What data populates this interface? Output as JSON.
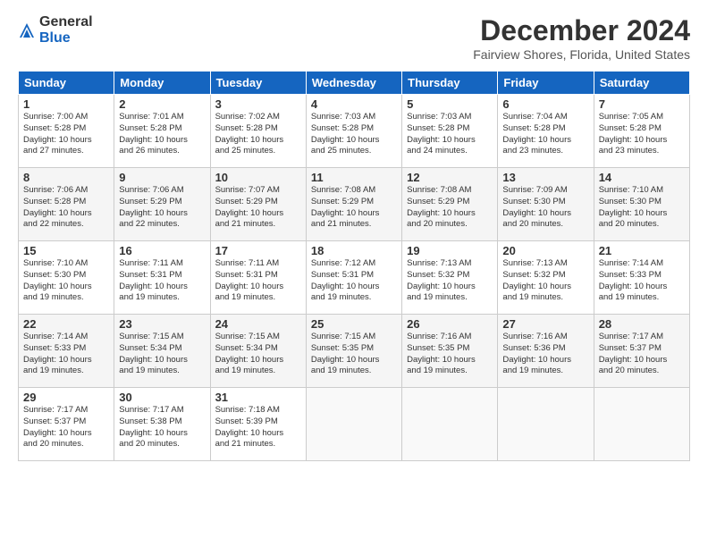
{
  "header": {
    "logo_general": "General",
    "logo_blue": "Blue",
    "title": "December 2024",
    "location": "Fairview Shores, Florida, United States"
  },
  "weekdays": [
    "Sunday",
    "Monday",
    "Tuesday",
    "Wednesday",
    "Thursday",
    "Friday",
    "Saturday"
  ],
  "weeks": [
    [
      {
        "day": "1",
        "info": "Sunrise: 7:00 AM\nSunset: 5:28 PM\nDaylight: 10 hours\nand 27 minutes."
      },
      {
        "day": "2",
        "info": "Sunrise: 7:01 AM\nSunset: 5:28 PM\nDaylight: 10 hours\nand 26 minutes."
      },
      {
        "day": "3",
        "info": "Sunrise: 7:02 AM\nSunset: 5:28 PM\nDaylight: 10 hours\nand 25 minutes."
      },
      {
        "day": "4",
        "info": "Sunrise: 7:03 AM\nSunset: 5:28 PM\nDaylight: 10 hours\nand 25 minutes."
      },
      {
        "day": "5",
        "info": "Sunrise: 7:03 AM\nSunset: 5:28 PM\nDaylight: 10 hours\nand 24 minutes."
      },
      {
        "day": "6",
        "info": "Sunrise: 7:04 AM\nSunset: 5:28 PM\nDaylight: 10 hours\nand 23 minutes."
      },
      {
        "day": "7",
        "info": "Sunrise: 7:05 AM\nSunset: 5:28 PM\nDaylight: 10 hours\nand 23 minutes."
      }
    ],
    [
      {
        "day": "8",
        "info": "Sunrise: 7:06 AM\nSunset: 5:28 PM\nDaylight: 10 hours\nand 22 minutes."
      },
      {
        "day": "9",
        "info": "Sunrise: 7:06 AM\nSunset: 5:29 PM\nDaylight: 10 hours\nand 22 minutes."
      },
      {
        "day": "10",
        "info": "Sunrise: 7:07 AM\nSunset: 5:29 PM\nDaylight: 10 hours\nand 21 minutes."
      },
      {
        "day": "11",
        "info": "Sunrise: 7:08 AM\nSunset: 5:29 PM\nDaylight: 10 hours\nand 21 minutes."
      },
      {
        "day": "12",
        "info": "Sunrise: 7:08 AM\nSunset: 5:29 PM\nDaylight: 10 hours\nand 20 minutes."
      },
      {
        "day": "13",
        "info": "Sunrise: 7:09 AM\nSunset: 5:30 PM\nDaylight: 10 hours\nand 20 minutes."
      },
      {
        "day": "14",
        "info": "Sunrise: 7:10 AM\nSunset: 5:30 PM\nDaylight: 10 hours\nand 20 minutes."
      }
    ],
    [
      {
        "day": "15",
        "info": "Sunrise: 7:10 AM\nSunset: 5:30 PM\nDaylight: 10 hours\nand 19 minutes."
      },
      {
        "day": "16",
        "info": "Sunrise: 7:11 AM\nSunset: 5:31 PM\nDaylight: 10 hours\nand 19 minutes."
      },
      {
        "day": "17",
        "info": "Sunrise: 7:11 AM\nSunset: 5:31 PM\nDaylight: 10 hours\nand 19 minutes."
      },
      {
        "day": "18",
        "info": "Sunrise: 7:12 AM\nSunset: 5:31 PM\nDaylight: 10 hours\nand 19 minutes."
      },
      {
        "day": "19",
        "info": "Sunrise: 7:13 AM\nSunset: 5:32 PM\nDaylight: 10 hours\nand 19 minutes."
      },
      {
        "day": "20",
        "info": "Sunrise: 7:13 AM\nSunset: 5:32 PM\nDaylight: 10 hours\nand 19 minutes."
      },
      {
        "day": "21",
        "info": "Sunrise: 7:14 AM\nSunset: 5:33 PM\nDaylight: 10 hours\nand 19 minutes."
      }
    ],
    [
      {
        "day": "22",
        "info": "Sunrise: 7:14 AM\nSunset: 5:33 PM\nDaylight: 10 hours\nand 19 minutes."
      },
      {
        "day": "23",
        "info": "Sunrise: 7:15 AM\nSunset: 5:34 PM\nDaylight: 10 hours\nand 19 minutes."
      },
      {
        "day": "24",
        "info": "Sunrise: 7:15 AM\nSunset: 5:34 PM\nDaylight: 10 hours\nand 19 minutes."
      },
      {
        "day": "25",
        "info": "Sunrise: 7:15 AM\nSunset: 5:35 PM\nDaylight: 10 hours\nand 19 minutes."
      },
      {
        "day": "26",
        "info": "Sunrise: 7:16 AM\nSunset: 5:35 PM\nDaylight: 10 hours\nand 19 minutes."
      },
      {
        "day": "27",
        "info": "Sunrise: 7:16 AM\nSunset: 5:36 PM\nDaylight: 10 hours\nand 19 minutes."
      },
      {
        "day": "28",
        "info": "Sunrise: 7:17 AM\nSunset: 5:37 PM\nDaylight: 10 hours\nand 20 minutes."
      }
    ],
    [
      {
        "day": "29",
        "info": "Sunrise: 7:17 AM\nSunset: 5:37 PM\nDaylight: 10 hours\nand 20 minutes."
      },
      {
        "day": "30",
        "info": "Sunrise: 7:17 AM\nSunset: 5:38 PM\nDaylight: 10 hours\nand 20 minutes."
      },
      {
        "day": "31",
        "info": "Sunrise: 7:18 AM\nSunset: 5:39 PM\nDaylight: 10 hours\nand 21 minutes."
      },
      {
        "day": "",
        "info": ""
      },
      {
        "day": "",
        "info": ""
      },
      {
        "day": "",
        "info": ""
      },
      {
        "day": "",
        "info": ""
      }
    ]
  ]
}
